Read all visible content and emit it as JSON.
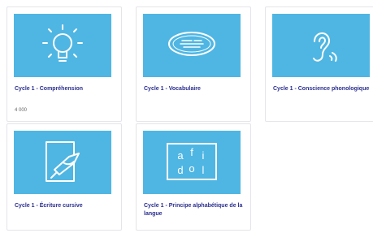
{
  "accent_color": "#4fb6e3",
  "title_color": "#2b2f8f",
  "cards": [
    {
      "title": "Cycle 1 - Compréhension",
      "meta": "4 000",
      "icon": "lightbulb-icon"
    },
    {
      "title": "Cycle 1 - Vocabulaire",
      "icon": "vocabulary-oval-icon"
    },
    {
      "title": "Cycle 1 - Conscience phonologique",
      "icon": "ear-icon"
    },
    {
      "title": "Cycle 1 - Écriture cursive",
      "icon": "writing-hand-icon"
    },
    {
      "title": "Cycle 1 - Principe alphabétique de la langue",
      "icon": "alphabet-letters-icon"
    }
  ],
  "alphabet_letters": [
    "a",
    "f",
    "i",
    "d",
    "o",
    "l"
  ]
}
